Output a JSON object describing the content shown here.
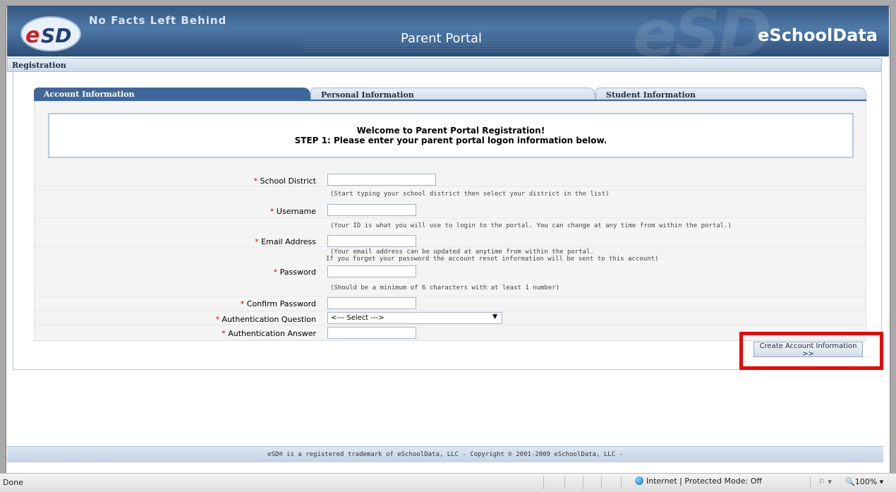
{
  "header": {
    "logo_text": "eSD",
    "tagline": "No Facts Left Behind",
    "portal_title": "Parent Portal",
    "brand": "eSchoolData"
  },
  "registration_bar": {
    "label": "Registration"
  },
  "tabs": [
    {
      "label": "Account Information",
      "active": true
    },
    {
      "label": "Personal Information",
      "active": false
    },
    {
      "label": "Student Information",
      "active": false
    }
  ],
  "welcome": {
    "line1": "Welcome to Parent Portal Registration!",
    "line2": "STEP 1: Please enter your parent portal logon information below."
  },
  "form": {
    "required_marker": "*",
    "school_district": {
      "label": "School District",
      "value": "",
      "hint": "(Start typing your school district then select your district in the list)"
    },
    "username": {
      "label": "Username",
      "value": "",
      "hint": "(Your ID is what you will use to login to the portal. You can change at any time from within the portal.)"
    },
    "email": {
      "label": "Email Address",
      "value": "",
      "hint_line1": "(Your email address can be updated at anytime from within the portal.",
      "hint_line2": "If you forget your password the account reset information will be sent to this account)"
    },
    "password": {
      "label": "Password",
      "value": "",
      "hint": "(Should be a minimum of 6 characters with at least 1 number)"
    },
    "confirm_password": {
      "label": "Confirm Password",
      "value": ""
    },
    "auth_question": {
      "label": "Authentication Question",
      "selected": "<--- Select --->"
    },
    "auth_answer": {
      "label": "Authentication Answer",
      "value": ""
    },
    "submit_label": "Create Account Information >>"
  },
  "footer": {
    "text": "eSD® is a registered trademark of eSchoolData, LLC - Copyright © 2001-2009 eSchoolData, LLC -"
  },
  "statusbar": {
    "status": "Done",
    "zone": "Internet | Protected Mode: Off",
    "zoom": "100%"
  },
  "colors": {
    "header_blue": "#3f689a",
    "highlight_red": "#ee0000",
    "required_red": "#d40000"
  }
}
